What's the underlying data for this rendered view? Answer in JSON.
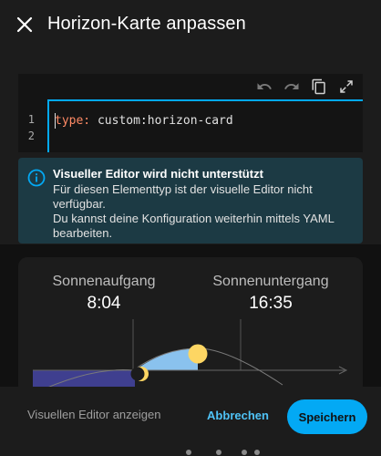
{
  "dialog": {
    "title": "Horizon-Karte anpassen"
  },
  "icons": {
    "close": "close-icon",
    "undo": "undo-icon",
    "redo": "redo-icon",
    "copy": "copy-icon",
    "fullscreen": "fullscreen-icon",
    "info": "info-icon"
  },
  "editor": {
    "lines": [
      {
        "number": "1",
        "key": "type:",
        "value": " custom:horizon-card"
      },
      {
        "number": "2",
        "key": "",
        "value": ""
      }
    ]
  },
  "alert": {
    "title": "Visueller Editor wird nicht unterstützt",
    "line1": "Für diesen Elementtyp ist der visuelle Editor nicht verfügbar.",
    "line2": "Du kannst deine Konfiguration weiterhin mittels YAML bearbeiten."
  },
  "preview": {
    "sunrise_label": "Sonnenaufgang",
    "sunrise_time": "8:04",
    "sunset_label": "Sonnenuntergang",
    "sunset_time": "16:35"
  },
  "footer": {
    "show_visual_editor": "Visuellen Editor anzeigen",
    "cancel": "Abbrechen",
    "save": "Speichern"
  },
  "colors": {
    "accent": "#03a9f4",
    "alert_bg": "#1c3a44",
    "sun": "#fdd663",
    "sky": "#8ac2ee",
    "night": "#3f3f8f"
  }
}
